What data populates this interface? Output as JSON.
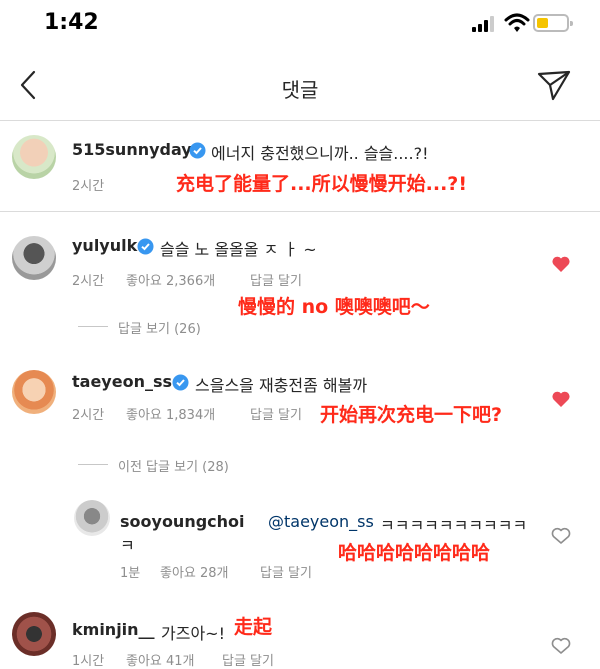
{
  "status_bar": {
    "time": "1:42"
  },
  "header": {
    "title": "댓글"
  },
  "caption": {
    "username": "515sunnyday",
    "text": "에너지 충전했으니까.. 슬슬....?!",
    "time": "2시간",
    "translation": "充电了能量了...所以慢慢开始...?!"
  },
  "comments": [
    {
      "username": "yulyulk",
      "text": "슬슬 노 올올올 ㅈ ㅏ ~",
      "time": "2시간",
      "likes": "좋아요 2,366개",
      "reply": "답글 달기",
      "translation": "慢慢的 no 噢噢噢吧～",
      "liked": true,
      "view_replies": "답글 보기 (26)"
    },
    {
      "username": "taeyeon_ss",
      "text": "스을스을 재충전좀 해볼까",
      "time": "2시간",
      "likes": "좋아요 1,834개",
      "reply": "답글 달기",
      "translation": "开始再次充电一下吧?",
      "liked": true,
      "view_replies": "이전 답글 보기 (28)"
    }
  ],
  "reply": {
    "username": "sooyoungchoi",
    "mention": "@taeyeon_ss",
    "text_line1": "ㅋㅋㅋㅋㅋㅋㅋㅋㅋㅋ",
    "text_line2": "ㅋ",
    "time": "1분",
    "likes": "좋아요 28개",
    "reply": "답글 달기",
    "translation": "哈哈哈哈哈哈哈哈",
    "liked": false
  },
  "last_comment": {
    "username": "kminjin__",
    "text": "가즈아~!",
    "time": "1시간",
    "likes": "좋아요 41개",
    "reply": "답글 달기",
    "translation": "走起",
    "liked": false
  },
  "colors": {
    "verified": "#3897f0",
    "like": "#ed4956",
    "annotation": "#ff2a1a"
  }
}
